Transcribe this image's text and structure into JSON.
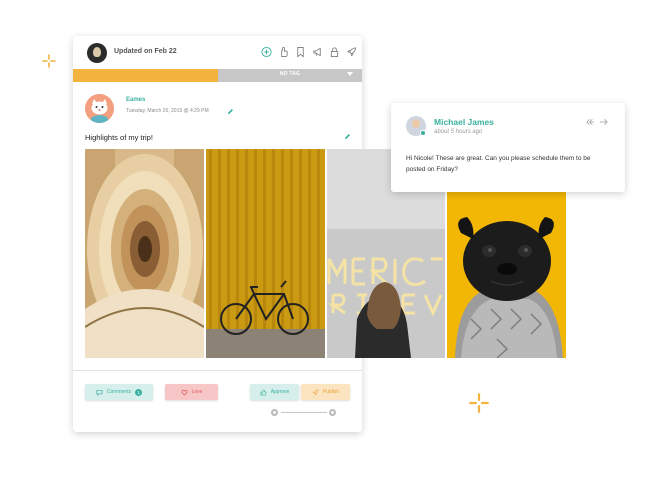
{
  "header": {
    "updated_label": "Updated on Feb 22",
    "icons": [
      "plus-circle-icon",
      "hand-icon",
      "bookmark-icon",
      "megaphone-icon",
      "lock-icon",
      "rocket-icon"
    ]
  },
  "tag_bar": {
    "label": "NO TAG"
  },
  "post": {
    "author": "Eames",
    "date": "Tuesday, March 26, 2019 @ 4:29 PM",
    "text": "Highlights of my trip!",
    "photos": [
      "spiral-staircase",
      "bicycle-yellow-wall",
      "neon-sign-woman",
      "pug-in-scarf"
    ]
  },
  "actions": {
    "comments_label": "Comments",
    "comments_count": "1",
    "love_label": "Love",
    "approve_label": "Approve",
    "publish_label": "Publish"
  },
  "comment": {
    "name": "Michael James",
    "time": "about 5 hours ago",
    "text": "Hi Nicole! These are great. Can you please schedule them to be posted on Friday?"
  },
  "colors": {
    "accent_teal": "#3bb0a0",
    "tag_orange": "#f4b23f",
    "love_red": "#e05a5a",
    "publish_orange": "#e7a235"
  }
}
